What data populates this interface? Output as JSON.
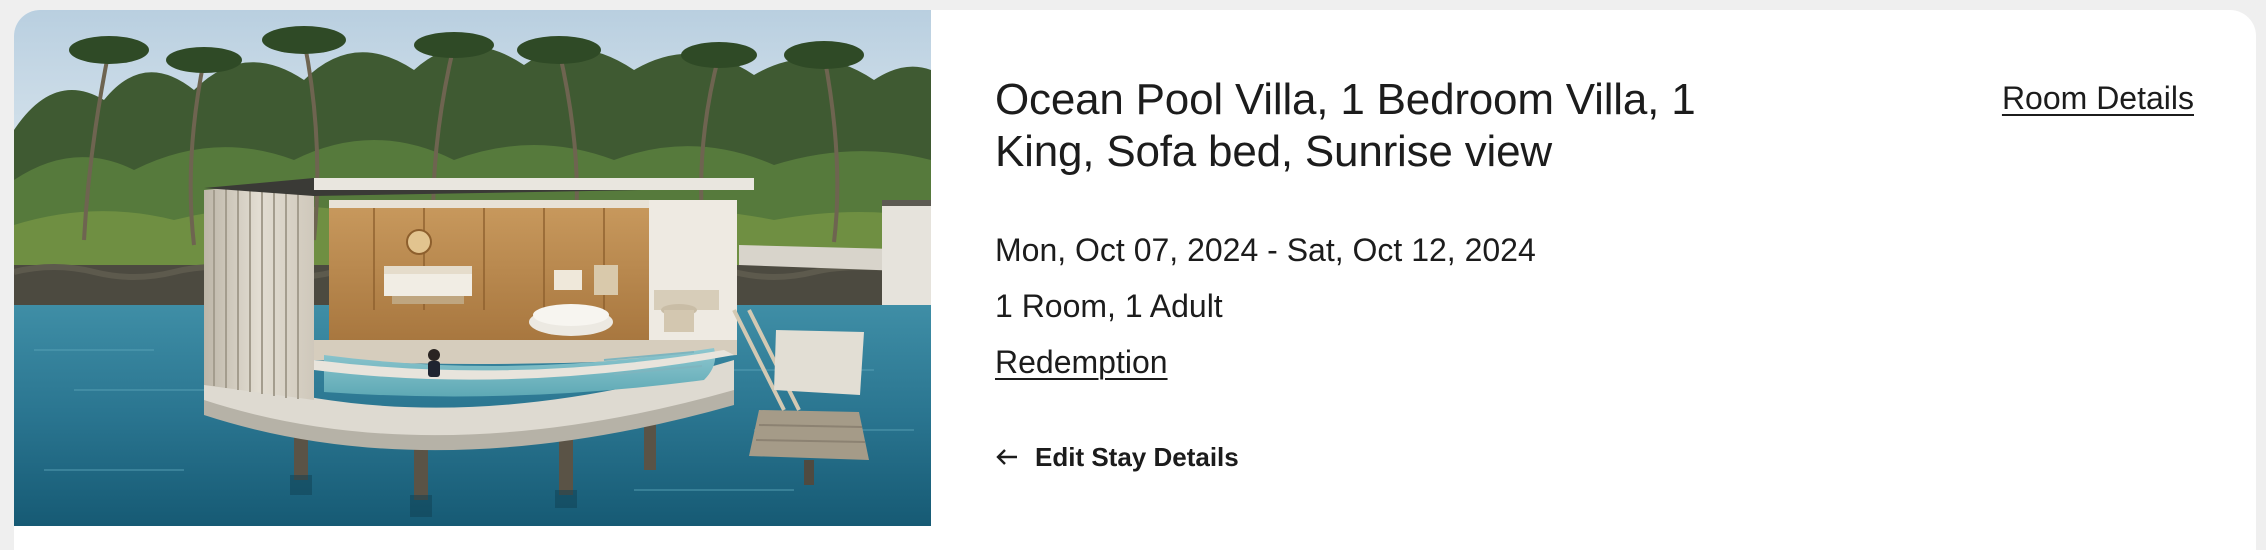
{
  "room": {
    "title": "Ocean Pool Villa, 1 Bedroom Villa, 1 King, Sofa bed, Sunrise view",
    "details_link": "Room Details",
    "dates": "Mon, Oct 07, 2024 - Sat, Oct 12, 2024",
    "occupancy": "1 Room, 1 Adult",
    "rate_type": "Redemption"
  },
  "actions": {
    "edit_stay": "Edit Stay Details",
    "edit_stay_icon": "arrow-left-icon"
  },
  "photo": {
    "subject": "overwater-villa-photo"
  },
  "colors": {
    "text": "#1c1c1c",
    "background": "#efefef",
    "card": "#ffffff"
  }
}
